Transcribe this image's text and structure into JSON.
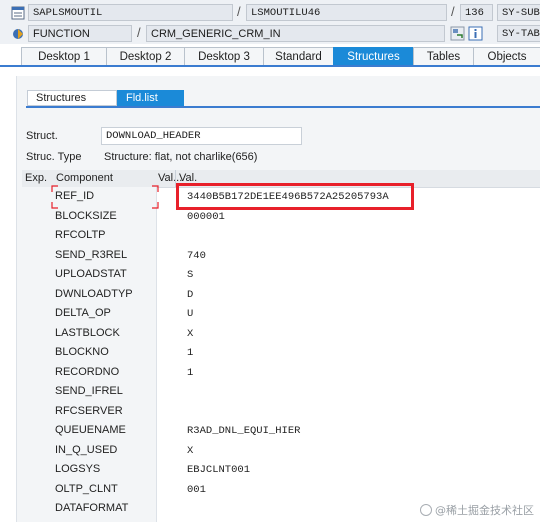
{
  "header": {
    "program": "SAPLSMOUTIL",
    "include": "LSMOUTILU46",
    "line": "136",
    "sysfield1": "SY-SUB",
    "event_type": "FUNCTION",
    "event_name": "CRM_GENERIC_CRM_IN",
    "sysfield2": "SY-TAB"
  },
  "tabs": [
    "Desktop 1",
    "Desktop 2",
    "Desktop 3",
    "Standard",
    "Structures",
    "Tables",
    "Objects"
  ],
  "subtabs": [
    "Structures",
    "Fld.list"
  ],
  "struct": {
    "label": "Struct.",
    "name": "DOWNLOAD_HEADER",
    "type_label": "Struc. Type",
    "type_value": "Structure: flat, not charlike(656)"
  },
  "table": {
    "headers": {
      "exp": "Exp.",
      "component": "Component",
      "val1": "Val...",
      "val2": "Val."
    },
    "rows": [
      {
        "component": "REF_ID",
        "value": "3440B5B172DE1EE496B572A25205793A"
      },
      {
        "component": "BLOCKSIZE",
        "value": "000001"
      },
      {
        "component": "RFCOLTP",
        "value": ""
      },
      {
        "component": "SEND_R3REL",
        "value": "740"
      },
      {
        "component": "UPLOADSTAT",
        "value": "S"
      },
      {
        "component": "DWNLOADTYP",
        "value": "D"
      },
      {
        "component": "DELTA_OP",
        "value": "U"
      },
      {
        "component": "LASTBLOCK",
        "value": "X"
      },
      {
        "component": "BLOCKNO",
        "value": "1"
      },
      {
        "component": "RECORDNO",
        "value": "1"
      },
      {
        "component": "SEND_IFREL",
        "value": ""
      },
      {
        "component": "RFCSERVER",
        "value": ""
      },
      {
        "component": "QUEUENAME",
        "value": "R3AD_DNL_EQUI_HIER"
      },
      {
        "component": "IN_Q_USED",
        "value": "X"
      },
      {
        "component": "LOGSYS",
        "value": "EBJCLNT001"
      },
      {
        "component": "OLTP_CLNT",
        "value": "001"
      },
      {
        "component": "DATAFORMAT",
        "value": ""
      }
    ]
  },
  "watermark": "@稀土掘金技术社区",
  "colors": {
    "accent": "#1b8ad8",
    "highlight": "#e8202a"
  }
}
